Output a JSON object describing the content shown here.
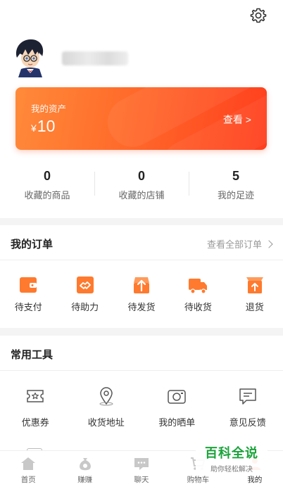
{
  "header": {
    "settings_icon": "gear-icon",
    "avatar_icon": "avatar-icon"
  },
  "assets": {
    "label": "我的资产",
    "currency": "¥",
    "amount": "10",
    "view_label": "查看 >",
    "gradient": [
      "#ff8a3a",
      "#ff3f1e"
    ]
  },
  "stats": [
    {
      "value": "0",
      "label": "收藏的商品"
    },
    {
      "value": "0",
      "label": "收藏的店铺"
    },
    {
      "value": "5",
      "label": "我的足迹"
    }
  ],
  "orders": {
    "title": "我的订单",
    "view_all": "查看全部订单",
    "items": [
      {
        "label": "待支付",
        "icon": "wallet-icon"
      },
      {
        "label": "待助力",
        "icon": "handshake-icon"
      },
      {
        "label": "待发货",
        "icon": "package-icon"
      },
      {
        "label": "待收货",
        "icon": "truck-icon"
      },
      {
        "label": "退货",
        "icon": "return-box-icon"
      }
    ]
  },
  "tools": {
    "title": "常用工具",
    "items": [
      {
        "label": "优惠券",
        "icon": "coupon-icon"
      },
      {
        "label": "收货地址",
        "icon": "location-icon"
      },
      {
        "label": "我的晒单",
        "icon": "camera-icon"
      },
      {
        "label": "意见反馈",
        "icon": "feedback-icon"
      }
    ]
  },
  "tabbar": [
    {
      "label": "首页",
      "icon": "home-icon"
    },
    {
      "label": "赚赚",
      "icon": "coin-bag-icon"
    },
    {
      "label": "聊天",
      "icon": "chat-icon"
    },
    {
      "label": "购物车",
      "icon": "cart-icon"
    },
    {
      "label": "我的",
      "icon": "profile-icon"
    }
  ],
  "watermark": {
    "title": "百科全说",
    "subtitle": "助你轻松解决"
  },
  "colors": {
    "accent": "#ff6a2a",
    "icon_orange": "#ff7a2e",
    "watermark_green": "#1aa33a"
  }
}
